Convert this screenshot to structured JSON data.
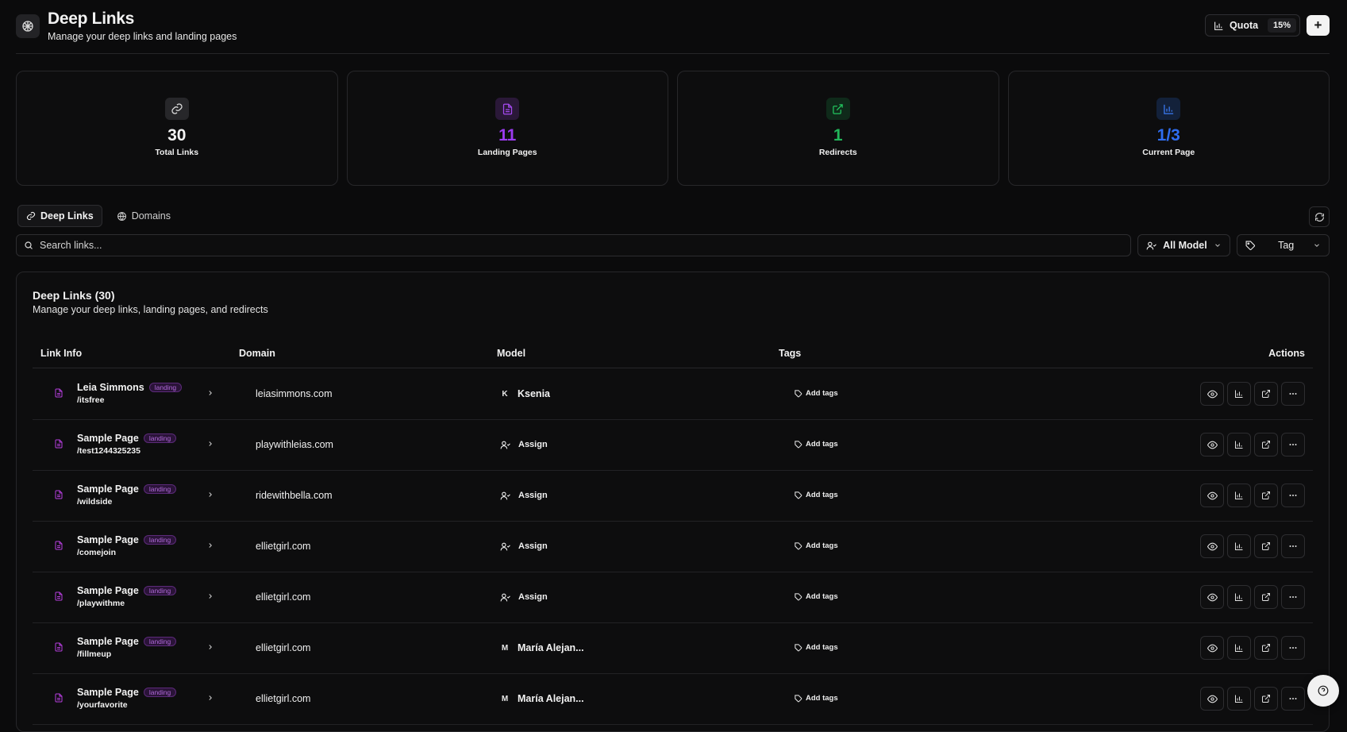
{
  "header": {
    "title": "Deep Links",
    "subtitle": "Manage your deep links and landing pages",
    "quota_label": "Quota",
    "quota_percent": "15%"
  },
  "stats": [
    {
      "value": "30",
      "label": "Total Links",
      "color": "#f4f4f4",
      "icon": "link-icon"
    },
    {
      "value": "11",
      "label": "Landing Pages",
      "color": "#9b3bf0",
      "icon": "file-icon"
    },
    {
      "value": "1",
      "label": "Redirects",
      "color": "#22b65a",
      "icon": "external-link-icon"
    },
    {
      "value": "1/3",
      "label": "Current Page",
      "color": "#2f6df0",
      "icon": "bar-chart-icon"
    }
  ],
  "tabs": [
    {
      "label": "Deep Links",
      "active": true
    },
    {
      "label": "Domains",
      "active": false
    }
  ],
  "filters": {
    "search_placeholder": "Search links...",
    "model_select": "All Model",
    "tag_select": "Tag"
  },
  "table": {
    "title": "Deep Links (30)",
    "subtitle": "Manage your deep links, landing pages, and redirects",
    "columns": [
      "Link Info",
      "Domain",
      "Model",
      "Tags",
      "Actions"
    ],
    "badge_label": "landing",
    "add_tags_label": "Add tags",
    "rows": [
      {
        "name": "Leia Simmons",
        "slug": "/itsfree",
        "domain": "leiasimmons.com",
        "model": "Ksenia",
        "avatar": "K",
        "assigned": true
      },
      {
        "name": "Sample Page",
        "slug": "/test1244325235",
        "domain": "playwithleias.com",
        "model": "Assign",
        "avatar": "",
        "assigned": false
      },
      {
        "name": "Sample Page",
        "slug": "/wildside",
        "domain": "ridewithbella.com",
        "model": "Assign",
        "avatar": "",
        "assigned": false
      },
      {
        "name": "Sample Page",
        "slug": "/comejoin",
        "domain": "ellietgirl.com",
        "model": "Assign",
        "avatar": "",
        "assigned": false
      },
      {
        "name": "Sample Page",
        "slug": "/playwithme",
        "domain": "ellietgirl.com",
        "model": "Assign",
        "avatar": "",
        "assigned": false
      },
      {
        "name": "Sample Page",
        "slug": "/fillmeup",
        "domain": "ellietgirl.com",
        "model": "María Alejan...",
        "avatar": "M",
        "assigned": true
      },
      {
        "name": "Sample Page",
        "slug": "/yourfavorite",
        "domain": "ellietgirl.com",
        "model": "María Alejan...",
        "avatar": "M",
        "assigned": true
      }
    ]
  }
}
